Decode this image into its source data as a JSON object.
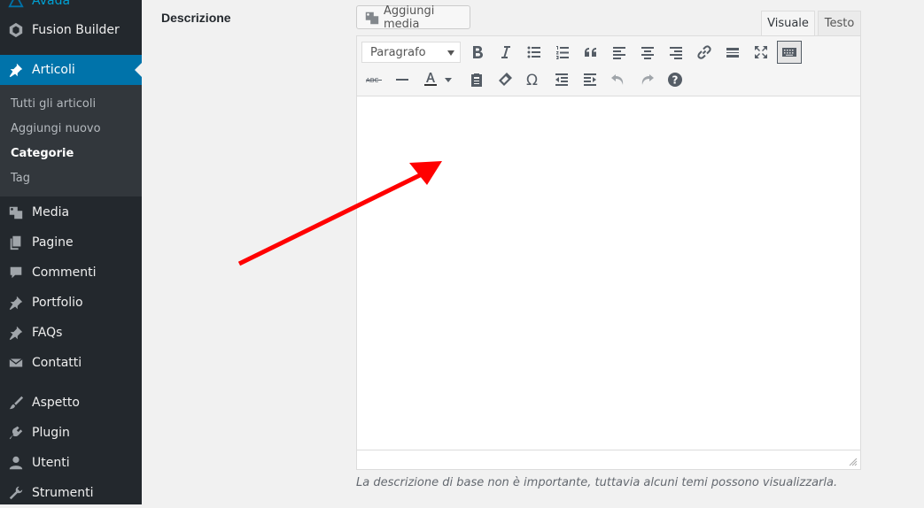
{
  "sidebar": {
    "items": [
      {
        "label": "Avada",
        "icon": "avada-icon"
      },
      {
        "label": "Fusion Builder",
        "icon": "fusion-icon"
      },
      {
        "label": "Articoli",
        "icon": "pushpin-icon",
        "active": true
      },
      {
        "label": "Media",
        "icon": "media-icon"
      },
      {
        "label": "Pagine",
        "icon": "pages-icon"
      },
      {
        "label": "Commenti",
        "icon": "comments-icon"
      },
      {
        "label": "Portfolio",
        "icon": "pushpin-icon"
      },
      {
        "label": "FAQs",
        "icon": "pushpin-icon"
      },
      {
        "label": "Contatti",
        "icon": "mail-icon"
      },
      {
        "label": "Aspetto",
        "icon": "brush-icon"
      },
      {
        "label": "Plugin",
        "icon": "plugin-icon"
      },
      {
        "label": "Utenti",
        "icon": "user-icon"
      },
      {
        "label": "Strumenti",
        "icon": "wrench-icon"
      }
    ],
    "submenu": [
      {
        "label": "Tutti gli articoli"
      },
      {
        "label": "Aggiungi nuovo"
      },
      {
        "label": "Categorie",
        "current": true
      },
      {
        "label": "Tag"
      }
    ]
  },
  "form": {
    "field_label": "Descrizione",
    "add_media_label": "Aggiungi media",
    "tab_visual": "Visuale",
    "tab_text": "Testo",
    "format_select_value": "Paragrafo",
    "description_hint": "La descrizione di base non è importante, tuttavia alcuni temi possono visualizzarla."
  },
  "colors": {
    "sidebar_bg": "#23282d",
    "submenu_bg": "#32373c",
    "active_bg": "#0073aa",
    "annotation_arrow": "#ff0000"
  }
}
